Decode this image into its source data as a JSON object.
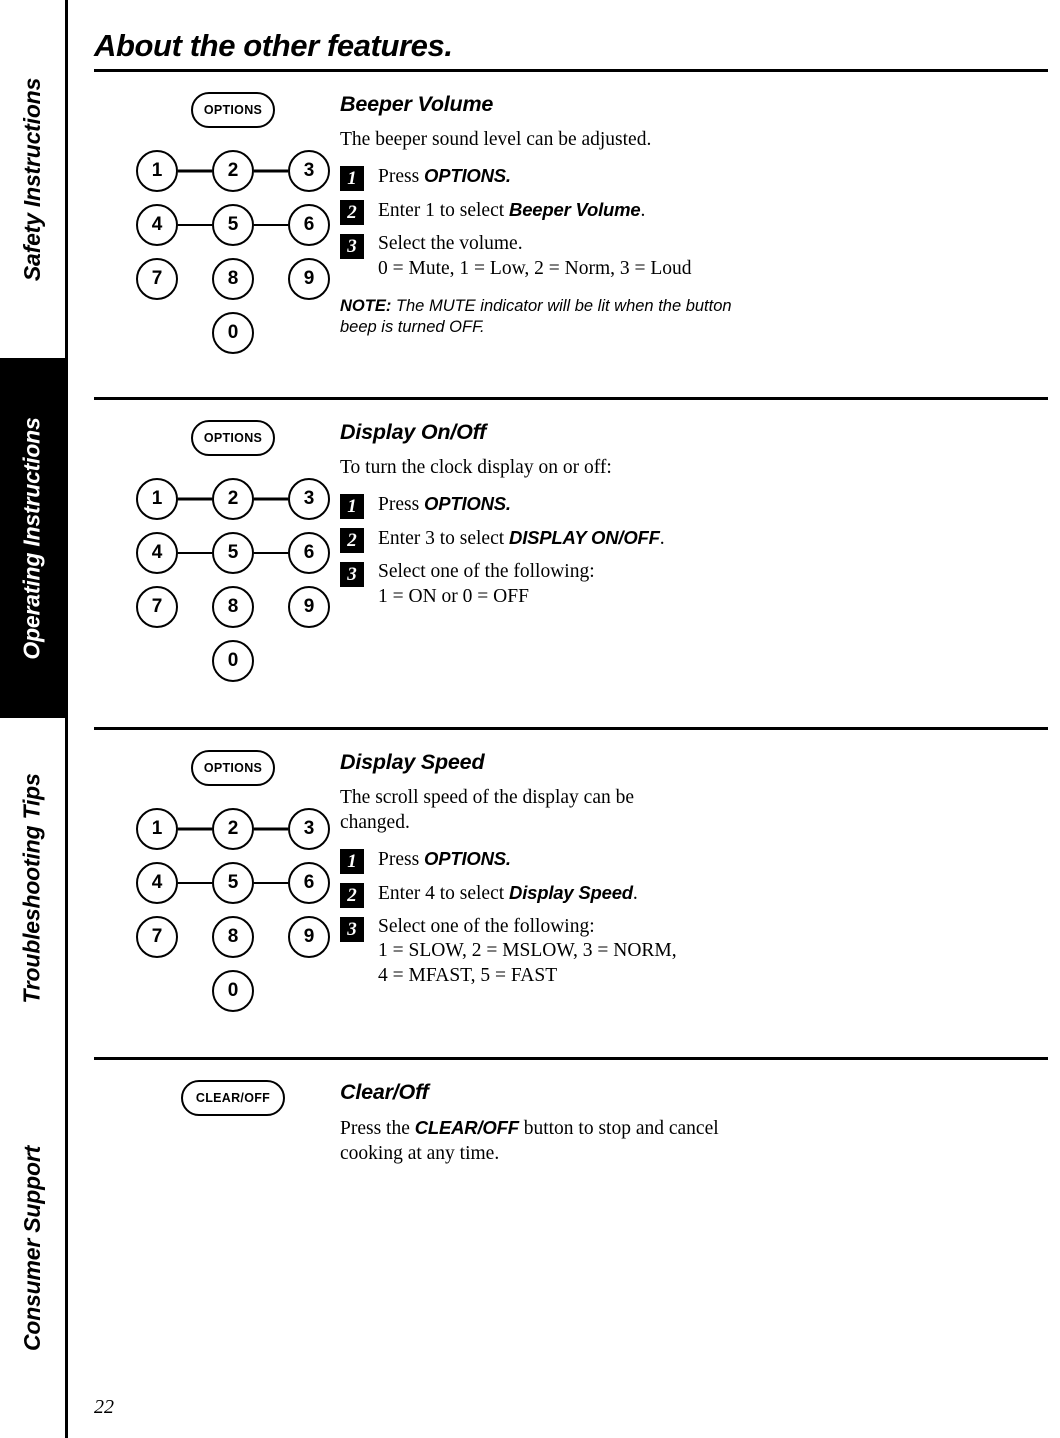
{
  "page": {
    "title": "About the other features.",
    "number": "22"
  },
  "sidebar": {
    "tabs": [
      {
        "label": "Safety Instructions",
        "style": "light"
      },
      {
        "label": "Operating Instructions",
        "style": "dark"
      },
      {
        "label": "Troubleshooting Tips",
        "style": "light"
      },
      {
        "label": "Consumer Support",
        "style": "light"
      }
    ]
  },
  "keypad": {
    "options_label": "OPTIONS",
    "clear_label": "CLEAR/OFF",
    "keys_row1": [
      "1",
      "2",
      "3"
    ],
    "keys_row2": [
      "4",
      "5",
      "6"
    ],
    "keys_row3": [
      "7",
      "8",
      "9"
    ],
    "keys_row4": [
      "0"
    ]
  },
  "sections": [
    {
      "heading": "Beeper Volume",
      "intro": "The beeper sound level can be adjusted.",
      "steps": [
        {
          "num": "1",
          "pre": "Press ",
          "strong": "OPTIONS.",
          "post": "",
          "line2": ""
        },
        {
          "num": "2",
          "pre": "Enter 1 to select ",
          "strong": "Beeper Volume",
          "post": ".",
          "line2": ""
        },
        {
          "num": "3",
          "pre": "Select the volume.",
          "strong": "",
          "post": "",
          "line2": "0 = Mute, 1 = Low, 2 = Norm, 3 = Loud"
        }
      ],
      "note_label": "NOTE:",
      "note_text": " The MUTE indicator will be lit when the button beep is turned OFF."
    },
    {
      "heading": "Display On/Off",
      "intro": "To turn the clock display on or off:",
      "steps": [
        {
          "num": "1",
          "pre": "Press ",
          "strong": "OPTIONS.",
          "post": "",
          "line2": ""
        },
        {
          "num": "2",
          "pre": "Enter 3 to select ",
          "strong": "DISPLAY ON/OFF",
          "post": ".",
          "line2": ""
        },
        {
          "num": "3",
          "pre": "Select one of the following:",
          "strong": "",
          "post": "",
          "line2": "1 = ON or 0 = OFF"
        }
      ],
      "note_label": "",
      "note_text": ""
    },
    {
      "heading": "Display Speed",
      "intro": "The scroll speed of the display can be changed.",
      "steps": [
        {
          "num": "1",
          "pre": "Press ",
          "strong": "OPTIONS.",
          "post": "",
          "line2": ""
        },
        {
          "num": "2",
          "pre": "Enter 4 to select ",
          "strong": "Display Speed",
          "post": ".",
          "line2": ""
        },
        {
          "num": "3",
          "pre": "Select one of the following:",
          "strong": "",
          "post": "",
          "line2": "1 = SLOW, 2 = MSLOW, 3 = NORM,",
          "line3": "4 = MFAST, 5 = FAST"
        }
      ],
      "note_label": "",
      "note_text": ""
    }
  ],
  "clear_section": {
    "heading": "Clear/Off",
    "body_pre": "Press the ",
    "body_strong": "CLEAR/OFF",
    "body_post": " button to stop and cancel cooking at any time."
  }
}
